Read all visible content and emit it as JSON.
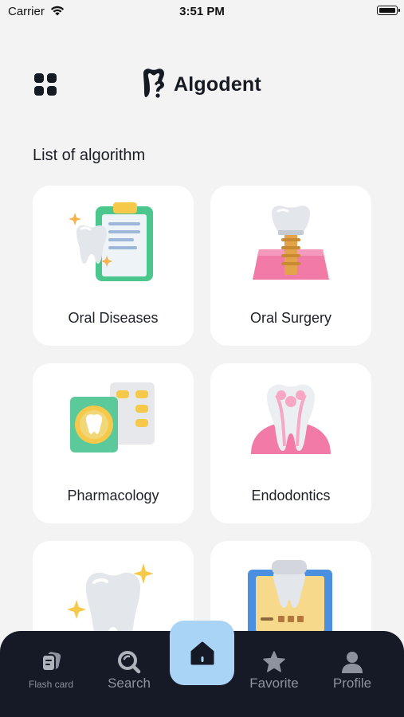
{
  "status_bar": {
    "carrier": "Carrier",
    "time": "3:51 PM",
    "battery_level": 1.0
  },
  "header": {
    "app_name": "Algodent",
    "menu_icon": "grid-icon",
    "logo_icon": "tooth-question-logo"
  },
  "section_title": "List of algorithm",
  "categories": [
    {
      "label": "Oral Diseases",
      "icon": "tooth-clipboard-illustration"
    },
    {
      "label": "Oral Surgery",
      "icon": "dental-implant-illustration"
    },
    {
      "label": "Pharmacology",
      "icon": "pill-blister-illustration"
    },
    {
      "label": "Endodontics",
      "icon": "tooth-root-illustration"
    },
    {
      "label": "",
      "icon": "sparkling-tooth-illustration"
    },
    {
      "label": "",
      "icon": "dental-xray-monitor-illustration"
    }
  ],
  "nav": {
    "items": [
      {
        "label": "Flash card",
        "icon": "flash-card-icon"
      },
      {
        "label": "Search",
        "icon": "search-icon"
      },
      {
        "label": "",
        "icon": "home-icon",
        "active": true
      },
      {
        "label": "Favorite",
        "icon": "star-icon"
      },
      {
        "label": "Profile",
        "icon": "person-icon"
      }
    ]
  },
  "colors": {
    "background": "#f3f3f4",
    "nav_background": "#161a26",
    "home_accent": "#a9d4f6",
    "card": "#ffffff"
  }
}
